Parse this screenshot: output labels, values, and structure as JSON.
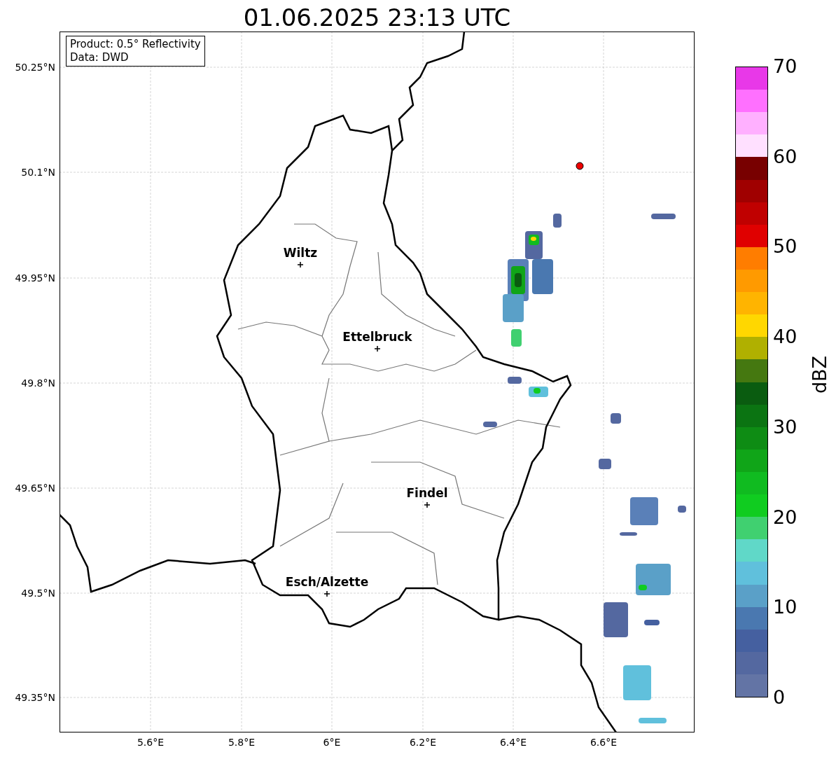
{
  "title": "01.06.2025 23:13 UTC",
  "info_box": {
    "lines": [
      "Product: 0.5° Reflectivity",
      "Data: DWD"
    ]
  },
  "map": {
    "yticks": [
      "50.25°N",
      "50.1°N",
      "49.95°N",
      "49.8°N",
      "49.65°N",
      "49.5°N",
      "49.35°N"
    ],
    "xticks": [
      "5.6°E",
      "5.8°E",
      "6°E",
      "6.2°E",
      "6.4°E",
      "6.6°E"
    ],
    "places": [
      {
        "name": "Wiltz"
      },
      {
        "name": "Ettelbruck"
      },
      {
        "name": "Findel"
      },
      {
        "name": "Esch/Alzette"
      }
    ]
  },
  "colorbar": {
    "label": "dBZ",
    "ticks": [
      "70",
      "60",
      "50",
      "40",
      "30",
      "20",
      "10",
      "0"
    ],
    "bins": [
      {
        "color": "#e838e8"
      },
      {
        "color": "#ff70ff"
      },
      {
        "color": "#ffb0ff"
      },
      {
        "color": "#ffe0ff"
      },
      {
        "color": "#780000"
      },
      {
        "color": "#a00000"
      },
      {
        "color": "#c00000"
      },
      {
        "color": "#e00000"
      },
      {
        "color": "#ff7d00"
      },
      {
        "color": "#ff9a00"
      },
      {
        "color": "#ffb400"
      },
      {
        "color": "#ffd700"
      },
      {
        "color": "#b0b000"
      },
      {
        "color": "#457810"
      },
      {
        "color": "#0a5c10"
      },
      {
        "color": "#0b7412"
      },
      {
        "color": "#0e8c14"
      },
      {
        "color": "#10a518"
      },
      {
        "color": "#10bb20"
      },
      {
        "color": "#10cc20"
      },
      {
        "color": "#40d070"
      },
      {
        "color": "#60d8c8"
      },
      {
        "color": "#60c0dc"
      },
      {
        "color": "#5aa0c8"
      },
      {
        "color": "#4a78b0"
      },
      {
        "color": "#4560a0"
      },
      {
        "color": "#5468a0"
      },
      {
        "color": "#6374a5"
      }
    ]
  }
}
